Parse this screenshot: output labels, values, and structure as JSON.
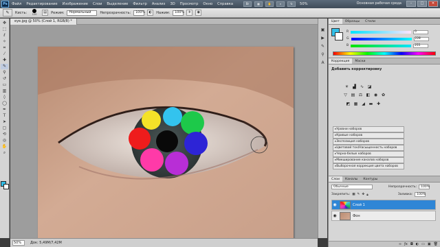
{
  "menubar": {
    "logo": "Ps",
    "items": [
      "Файл",
      "Редактирование",
      "Изображение",
      "Слои",
      "Выделение",
      "Фильтр",
      "Анализ",
      "3D",
      "Просмотр",
      "Окно",
      "Справка"
    ],
    "zoom": "50%",
    "workspace": "Основная рабочая среда"
  },
  "options": {
    "brush_label": "Кисть:",
    "brush_size": "120",
    "mode_label": "Режим:",
    "mode_value": "Нормальный",
    "opacity_label": "Непрозрачность:",
    "opacity_value": "100%",
    "pressure_label": "Нажим:",
    "pressure_value": "100%"
  },
  "document": {
    "tab_title": "eye.jpg @ 50% (Слой 1, RGB/8) *"
  },
  "status": {
    "zoom": "50%",
    "doc_info": "Док: 5,49M/7,42M"
  },
  "color_panel": {
    "tabs": [
      "Цвет",
      "Образцы",
      "Стили"
    ],
    "fg_color": "#33bfe8",
    "channels": [
      {
        "label": "R",
        "value": "0"
      },
      {
        "label": "G",
        "value": "228"
      },
      {
        "label": "B",
        "value": "255"
      }
    ]
  },
  "adjust_panel": {
    "tabs": [
      "Коррекция",
      "Маски"
    ],
    "title": "Добавить корректировку",
    "row1_icons": [
      "brightness-icon",
      "levels-icon",
      "curves-icon",
      "exposure-icon"
    ],
    "row2_icons": [
      "vibrance-icon",
      "hue-sat-icon",
      "color-balance-icon",
      "bw-icon",
      "photo-filter-icon",
      "channel-mixer-icon"
    ],
    "row3_icons": [
      "invert-icon",
      "posterize-icon",
      "threshold-icon",
      "gradient-map-icon",
      "selective-color-icon"
    ],
    "presets": [
      "Уровни наборов",
      "Кривые наборов",
      "Экспозиция наборов",
      "Цветовой тон/Насыщенность наборов",
      "Черно-белые наборов",
      "Микширование каналов наборов",
      "Выборочная коррекция цвета наборов"
    ]
  },
  "layers_panel": {
    "tabs": [
      "Слои",
      "Каналы",
      "Контуры"
    ],
    "blend_mode": "Обычные",
    "opacity_label": "Непрозрачность:",
    "opacity_value": "100%",
    "lock_label": "Закрепить:",
    "fill_label": "Заливка:",
    "fill_value": "100%",
    "layers": [
      {
        "name": "Слой 1",
        "active": true
      },
      {
        "name": "Фон",
        "active": false
      }
    ]
  }
}
